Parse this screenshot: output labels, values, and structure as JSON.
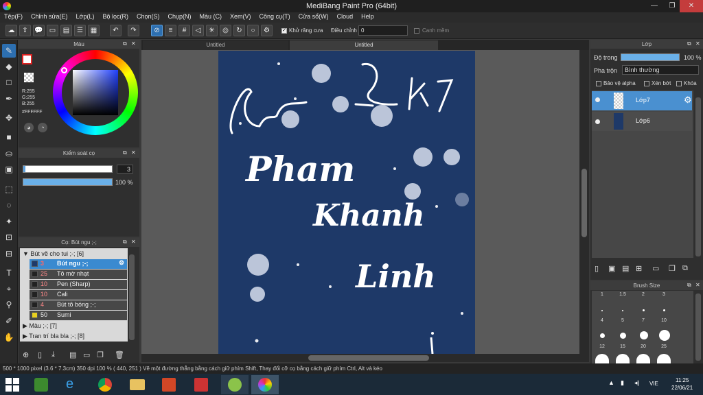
{
  "window": {
    "title": "MediBang Paint Pro (64bit)"
  },
  "menu": [
    "Tệp(F)",
    "Chỉnh sửa(E)",
    "Lớp(L)",
    "Bộ lọc(R)",
    "Chọn(S)",
    "Chụp(N)",
    "Màu (C)",
    "Xem(V)",
    "Công cụ(T)",
    "Cửa sổ(W)",
    "Cloud",
    "Help"
  ],
  "toolbar": {
    "antialias_label": "Khử răng cưa",
    "correction_label": "Điều chỉnh",
    "correction_value": "0",
    "smooth_label": "Canh mềm"
  },
  "tabs": [
    "Untitled",
    "Untitled"
  ],
  "color_panel": {
    "title": "Màu",
    "r": "R:255",
    "g": "G:255",
    "b": "B:255",
    "hex": "#FFFFFF"
  },
  "brush_control": {
    "title": "Kiểm soát cọ",
    "size": "3",
    "opacity": "100 %"
  },
  "brush_panel": {
    "title": "Cọ: Bút ngu ;-;",
    "groups": [
      {
        "label": "Bút vẽ cho tui ;-; [6]",
        "items": [
          {
            "size": "3",
            "name": "Bút ngu ;-;",
            "selected": true
          },
          {
            "size": "25",
            "name": "Tô mờ nhạt"
          },
          {
            "size": "10",
            "name": "Pen (Sharp)"
          },
          {
            "size": "10",
            "name": "Cali"
          },
          {
            "size": "4",
            "name": "Bút tô bóng ;-;"
          },
          {
            "size": "50",
            "name": "Sumi"
          }
        ]
      },
      {
        "label": "Màu ;-; [7]"
      },
      {
        "label": "Tran trí bla bla ;-; [8]"
      }
    ]
  },
  "layer_panel": {
    "title": "Lớp",
    "opacity_label": "Độ trong",
    "opacity_value": "100 %",
    "blend_label": "Pha trộn",
    "blend_value": "Bình thường",
    "protect_alpha": "Bảo vệ alpha",
    "clipping": "Xén bớt",
    "lock": "Khóa",
    "layers": [
      "Lớp7",
      "Lớp6"
    ]
  },
  "brush_size_panel": {
    "title": "Brush Size",
    "sizes": [
      "1",
      "1.5",
      "2",
      "3",
      "4",
      "5",
      "7",
      "10",
      "12",
      "15",
      "20",
      "25"
    ]
  },
  "status": {
    "text": "500 * 1000 pixel   (3.6 * 7.3cm)   350 dpi   100 %   ( 440, 251 )   Vẽ một đường thẳng bằng cách giữ phím Shift, Thay đổi cỡ cọ bằng cách giữ phím Ctrl, Alt và kéo"
  },
  "taskbar": {
    "lang": "VIE",
    "time": "11:25",
    "date": "22/06/21"
  },
  "canvas_text": [
    "Pham",
    "Khanh",
    "Linh",
    "2K7"
  ],
  "colors": {
    "canvas": "#1e3968",
    "accent": "#2d6fb0",
    "layer_selected": "#4a90d0"
  }
}
